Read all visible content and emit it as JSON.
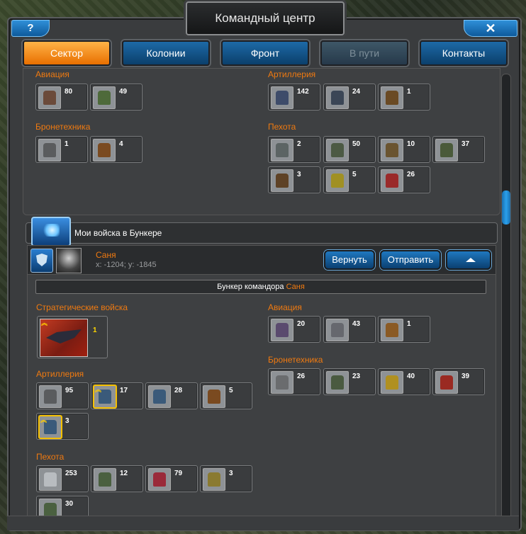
{
  "window": {
    "title": "Командный центр",
    "help_label": "?",
    "close_label": "✕"
  },
  "tabs": [
    {
      "label": "Сектор",
      "state": "active"
    },
    {
      "label": "Колонии",
      "state": "normal"
    },
    {
      "label": "Фронт",
      "state": "normal"
    },
    {
      "label": "В пути",
      "state": "disabled"
    },
    {
      "label": "Контакты",
      "state": "normal"
    }
  ],
  "sector": {
    "aviation": {
      "label": "Авиация",
      "units": [
        {
          "count": "80",
          "icon": "heavy-mech-icon"
        },
        {
          "count": "49",
          "icon": "green-mech-icon"
        }
      ]
    },
    "artillery": {
      "label": "Артиллерия",
      "units": [
        {
          "count": "142",
          "icon": "blue-mech-icon"
        },
        {
          "count": "24",
          "icon": "artillery-walker-icon"
        },
        {
          "count": "1",
          "icon": "brown-mech-icon"
        }
      ]
    },
    "armor": {
      "label": "Бронетехника",
      "units": [
        {
          "count": "1",
          "icon": "gray-tank-icon"
        },
        {
          "count": "4",
          "icon": "brown-tank-icon"
        }
      ]
    },
    "infantry": {
      "label": "Пехота",
      "units": [
        {
          "count": "2",
          "icon": "soldier-icon"
        },
        {
          "count": "50",
          "icon": "gunner-icon"
        },
        {
          "count": "10",
          "icon": "heavy-gunner-icon"
        },
        {
          "count": "37",
          "icon": "kneeling-soldier-icon"
        },
        {
          "count": "3",
          "icon": "brown-soldier-icon"
        },
        {
          "count": "5",
          "icon": "yellow-walker-icon"
        },
        {
          "count": "26",
          "icon": "red-robot-icon"
        }
      ]
    }
  },
  "bunker": {
    "header": "Мои войска в Бункере",
    "player": {
      "name": "Саня",
      "coords": "x: -1204; y: -1845"
    },
    "buttons": {
      "return": "Вернуть",
      "send": "Отправить"
    },
    "label_prefix": "Бункер командора",
    "label_name": "Саня",
    "strategic": {
      "label": "Стратегические войска",
      "count": "1",
      "icon": "strategic-ship-icon"
    },
    "aviation": {
      "label": "Авиация",
      "units": [
        {
          "count": "20",
          "icon": "purple-fighter-icon"
        },
        {
          "count": "43",
          "icon": "gray-fighter-icon"
        },
        {
          "count": "1",
          "icon": "orange-fighter-icon"
        }
      ]
    },
    "armor": {
      "label": "Бронетехника",
      "units": [
        {
          "count": "26",
          "icon": "gray-spider-icon"
        },
        {
          "count": "23",
          "icon": "green-spider-icon"
        },
        {
          "count": "40",
          "icon": "yellow-spider-icon"
        },
        {
          "count": "39",
          "icon": "red-spider-icon"
        }
      ]
    },
    "artillery": {
      "label": "Артиллерия",
      "units": [
        {
          "count": "95",
          "icon": "gray-tank-icon"
        },
        {
          "count": "17",
          "icon": "blue-claw-icon"
        },
        {
          "count": "28",
          "icon": "blue-claw-icon"
        },
        {
          "count": "5",
          "icon": "brown-tank-icon"
        },
        {
          "count": "3",
          "icon": "blue-claw-icon"
        }
      ]
    },
    "infantry": {
      "label": "Пехота",
      "units": [
        {
          "count": "253",
          "icon": "white-robot-icon"
        },
        {
          "count": "12",
          "icon": "green-soldier-icon"
        },
        {
          "count": "79",
          "icon": "red-robot-icon"
        },
        {
          "count": "3",
          "icon": "yellow-soldier-icon"
        },
        {
          "count": "30",
          "icon": "green-soldier-icon"
        }
      ]
    }
  }
}
